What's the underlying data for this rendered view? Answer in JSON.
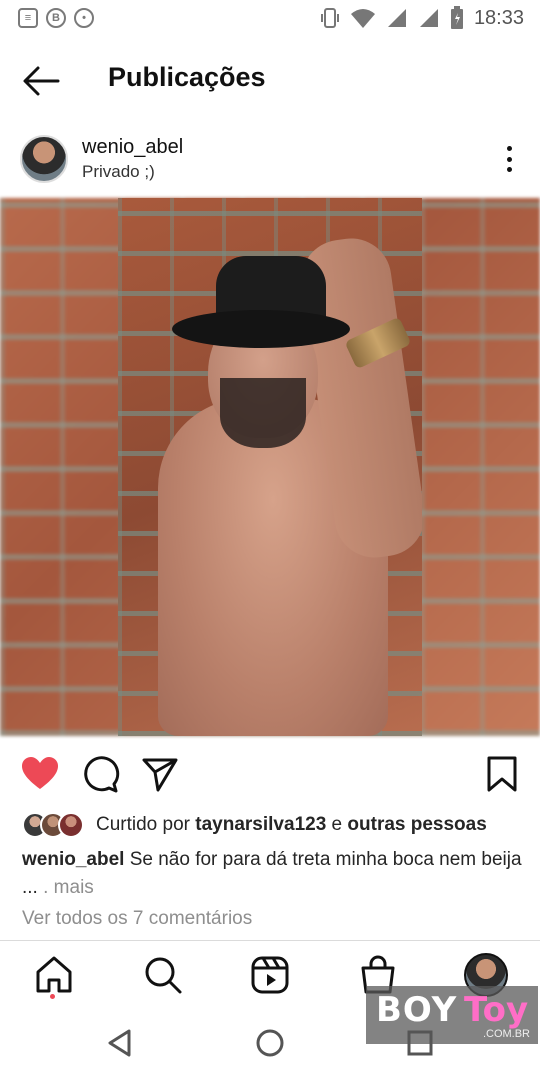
{
  "status_bar": {
    "time": "18:33",
    "left_icons": [
      "message-icon",
      "b-icon",
      "circle-icon"
    ],
    "right_icons": [
      "vibrate-icon",
      "wifi-icon",
      "signal-icon",
      "signal-icon",
      "battery-icon"
    ]
  },
  "header": {
    "title": "Publicações",
    "back_icon": "arrow-left-icon"
  },
  "post": {
    "username": "wenio_abel",
    "subtitle": "Privado ;)",
    "more_icon": "more-vertical-icon",
    "image_alt": "post-photo"
  },
  "actions": {
    "like_icon": "heart-filled-icon",
    "comment_icon": "comment-icon",
    "share_icon": "send-icon",
    "save_icon": "bookmark-icon",
    "like_color": "#ed4956"
  },
  "likes": {
    "prefix": "Curtido por ",
    "user": "taynarsilva123",
    "conjunction": " e ",
    "others": "outras pessoas"
  },
  "caption": {
    "username": "wenio_abel",
    "text": " Se não for para dá treta minha boca nem beija ...",
    "more": ". mais"
  },
  "comments_link": "Ver todos os 7 comentários",
  "bottom_nav": {
    "items": [
      "home-icon",
      "search-icon",
      "reels-icon",
      "shop-icon",
      "profile-avatar"
    ],
    "active": "home-icon"
  },
  "watermark": {
    "part1": "BOY",
    "part2": "Toy",
    "sub": ".COM.BR",
    "color": "#ff6ec7"
  },
  "system_nav": [
    "back-triangle-icon",
    "home-circle-icon",
    "recents-square-icon"
  ]
}
